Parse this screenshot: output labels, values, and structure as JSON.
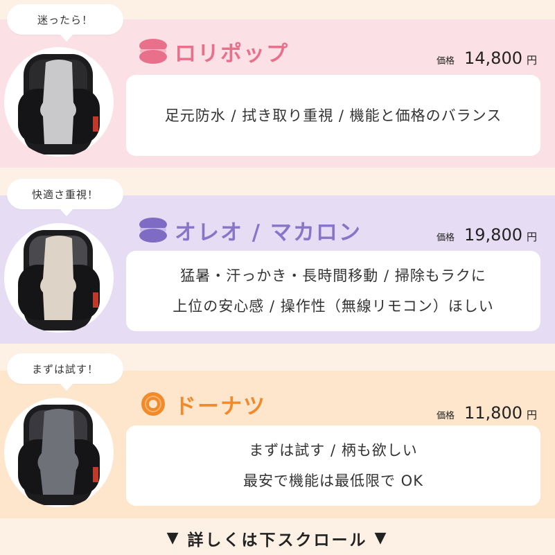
{
  "products": [
    {
      "badge": "迷ったら！",
      "name": "ロリポップ",
      "name_color": "#e8708a",
      "price_label": "価格",
      "price": "14,800",
      "currency": "円",
      "features": [
        "足元防水 / 拭き取り重視 / 機能と価格のバランス"
      ],
      "icon": "macaron-pink-icon",
      "cushion_color": "#c9c9cc"
    },
    {
      "badge": "快適さ重視！",
      "name": "オレオ / マカロン",
      "name_color": "#8875c8",
      "price_label": "価格",
      "price": "19,800",
      "currency": "円",
      "features": [
        "猛暑・汗っかき・長時間移動 / 掃除もラクに",
        "上位の安心感 / 操作性（無線リモコン）ほしい"
      ],
      "icon": "macaron-purple-icon",
      "cushion_color": "#ddd3c6"
    },
    {
      "badge": "まずは試す！",
      "name": "ドーナツ",
      "name_color": "#f08a2a",
      "price_label": "価格",
      "price": "11,800",
      "currency": "円",
      "features": [
        "まずは試す / 柄も欲しい",
        "最安で機能は最低限で OK"
      ],
      "icon": "donut-orange-icon",
      "cushion_color": "#6f7178"
    }
  ],
  "footer": {
    "text": "詳しくは下スクロール",
    "arrow": "▼"
  }
}
